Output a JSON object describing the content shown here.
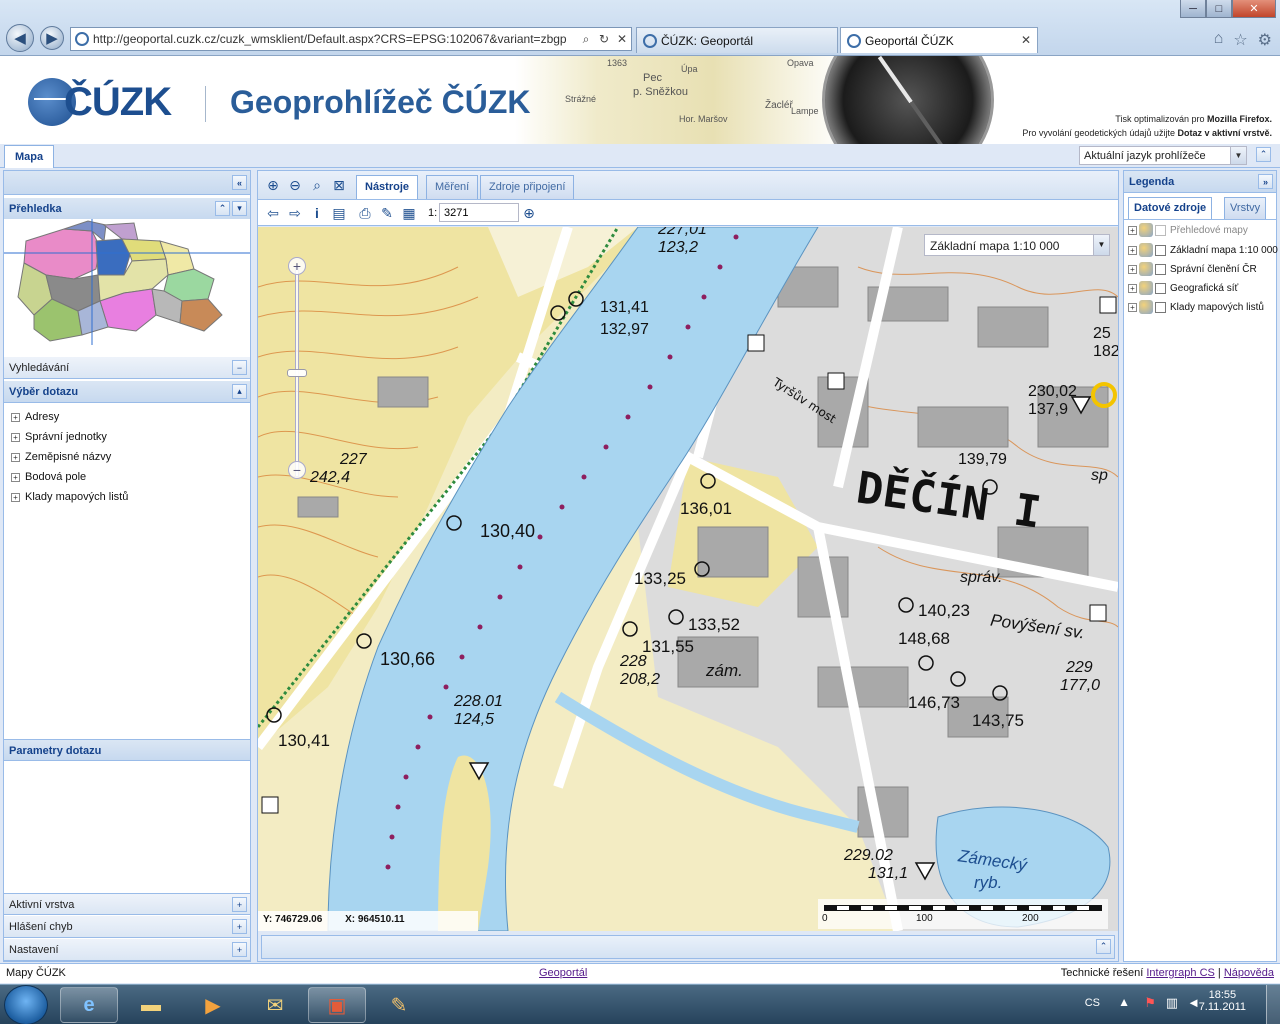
{
  "browser": {
    "url": "http://geoportal.cuzk.cz/cuzk_wmsklient/Default.aspx?CRS=EPSG:102067&variant=zbgp",
    "tabs": [
      {
        "label": "ČÚZK: Geoportál",
        "active": false
      },
      {
        "label": "Geoportál ČÚZK",
        "active": true
      }
    ],
    "window_buttons": {
      "minimize": "─",
      "maximize": "□",
      "close": "✕"
    }
  },
  "header": {
    "logo_text": "ČÚZK",
    "title": "Geoprohlížeč ČÚZK",
    "map_labels": [
      "Pec",
      "p. Sněžkou",
      "Strážné",
      "Opava",
      "Žacléř",
      "Hor. Maršov",
      "Lampe",
      "1363",
      "Úpa"
    ],
    "info_line1_prefix": "Tisk optimalizován pro ",
    "info_line1_bold": "Mozilla Firefox.",
    "info_line2_prefix": "Pro vyvolání geodetických údajů užijte ",
    "info_line2_bold": "Dotaz v aktivní vrstvě."
  },
  "main_tab": "Mapa",
  "language_select": "Aktuální jazyk prohlížeče",
  "left_panel": {
    "overview_title": "Přehledka",
    "search_title": "Vyhledávání",
    "query_title": "Výběr dotazu",
    "query_items": [
      "Adresy",
      "Správní jednotky",
      "Zeměpisné názvy",
      "Bodová pole",
      "Klady mapových listů"
    ],
    "params_title": "Parametry dotazu",
    "bottom_sections": [
      "Aktivní vrstva",
      "Hlášení chyb",
      "Nastavení"
    ]
  },
  "map_toolbar": {
    "tabs": [
      "Nástroje",
      "Měření",
      "Zdroje připojení"
    ],
    "active_tab": "Nástroje",
    "scale_prefix": "1:",
    "scale_value": "3271"
  },
  "map": {
    "basemap_select": "Základní mapa 1:10 000",
    "coord_y": "Y: 746729.06",
    "coord_x": "X: 964510.11",
    "scale_ticks": [
      "0",
      "100",
      "200"
    ],
    "labels": {
      "town": "DĚČÍN I",
      "bridge": "Tyršův most",
      "zamek": "zám.",
      "sprav": "správ.",
      "povyseni": "Povýšení sv.",
      "pond1": "Zámecký",
      "pond2": "ryb.",
      "sp": "sp"
    },
    "heights": [
      "227,01",
      "123,2",
      "131,41",
      "132,97",
      "230,02",
      "137,9",
      "139,79",
      "182,",
      "227",
      "242,4",
      "130,40",
      "136,01",
      "133,25",
      "133,52",
      "131,55",
      "140,23",
      "148,68",
      "228",
      "208,2",
      "229",
      "177,0",
      "146,73",
      "143,75",
      "130,66",
      "228.01",
      "124,5",
      "130,41",
      "229.02",
      "131,1",
      "25"
    ]
  },
  "legend": {
    "title": "Legenda",
    "tabs": [
      "Datové zdroje",
      "Vrstvy"
    ],
    "items": [
      {
        "label": "Přehledové mapy",
        "enabled": false
      },
      {
        "label": "Základní mapa 1:10 000",
        "enabled": true
      },
      {
        "label": "Správní členění ČR",
        "enabled": true
      },
      {
        "label": "Geografická síť",
        "enabled": true
      },
      {
        "label": "Klady mapových listů",
        "enabled": true
      }
    ]
  },
  "footer": {
    "left": "Mapy ČÚZK",
    "center_link": "Geoportál",
    "right_prefix": "Technické řešení ",
    "right_link1": "Intergraph CS",
    "separator": "|",
    "right_link2": "Nápověda"
  },
  "taskbar": {
    "lang": "CS",
    "time": "18:55",
    "date": "7.11.2011"
  },
  "colors": {
    "accent": "#15428b",
    "panel_border": "#99bbe8",
    "river": "#a8d5f0",
    "town": "#b3b3b3",
    "forest": "#f0e8b0",
    "contour": "#d9853b"
  }
}
